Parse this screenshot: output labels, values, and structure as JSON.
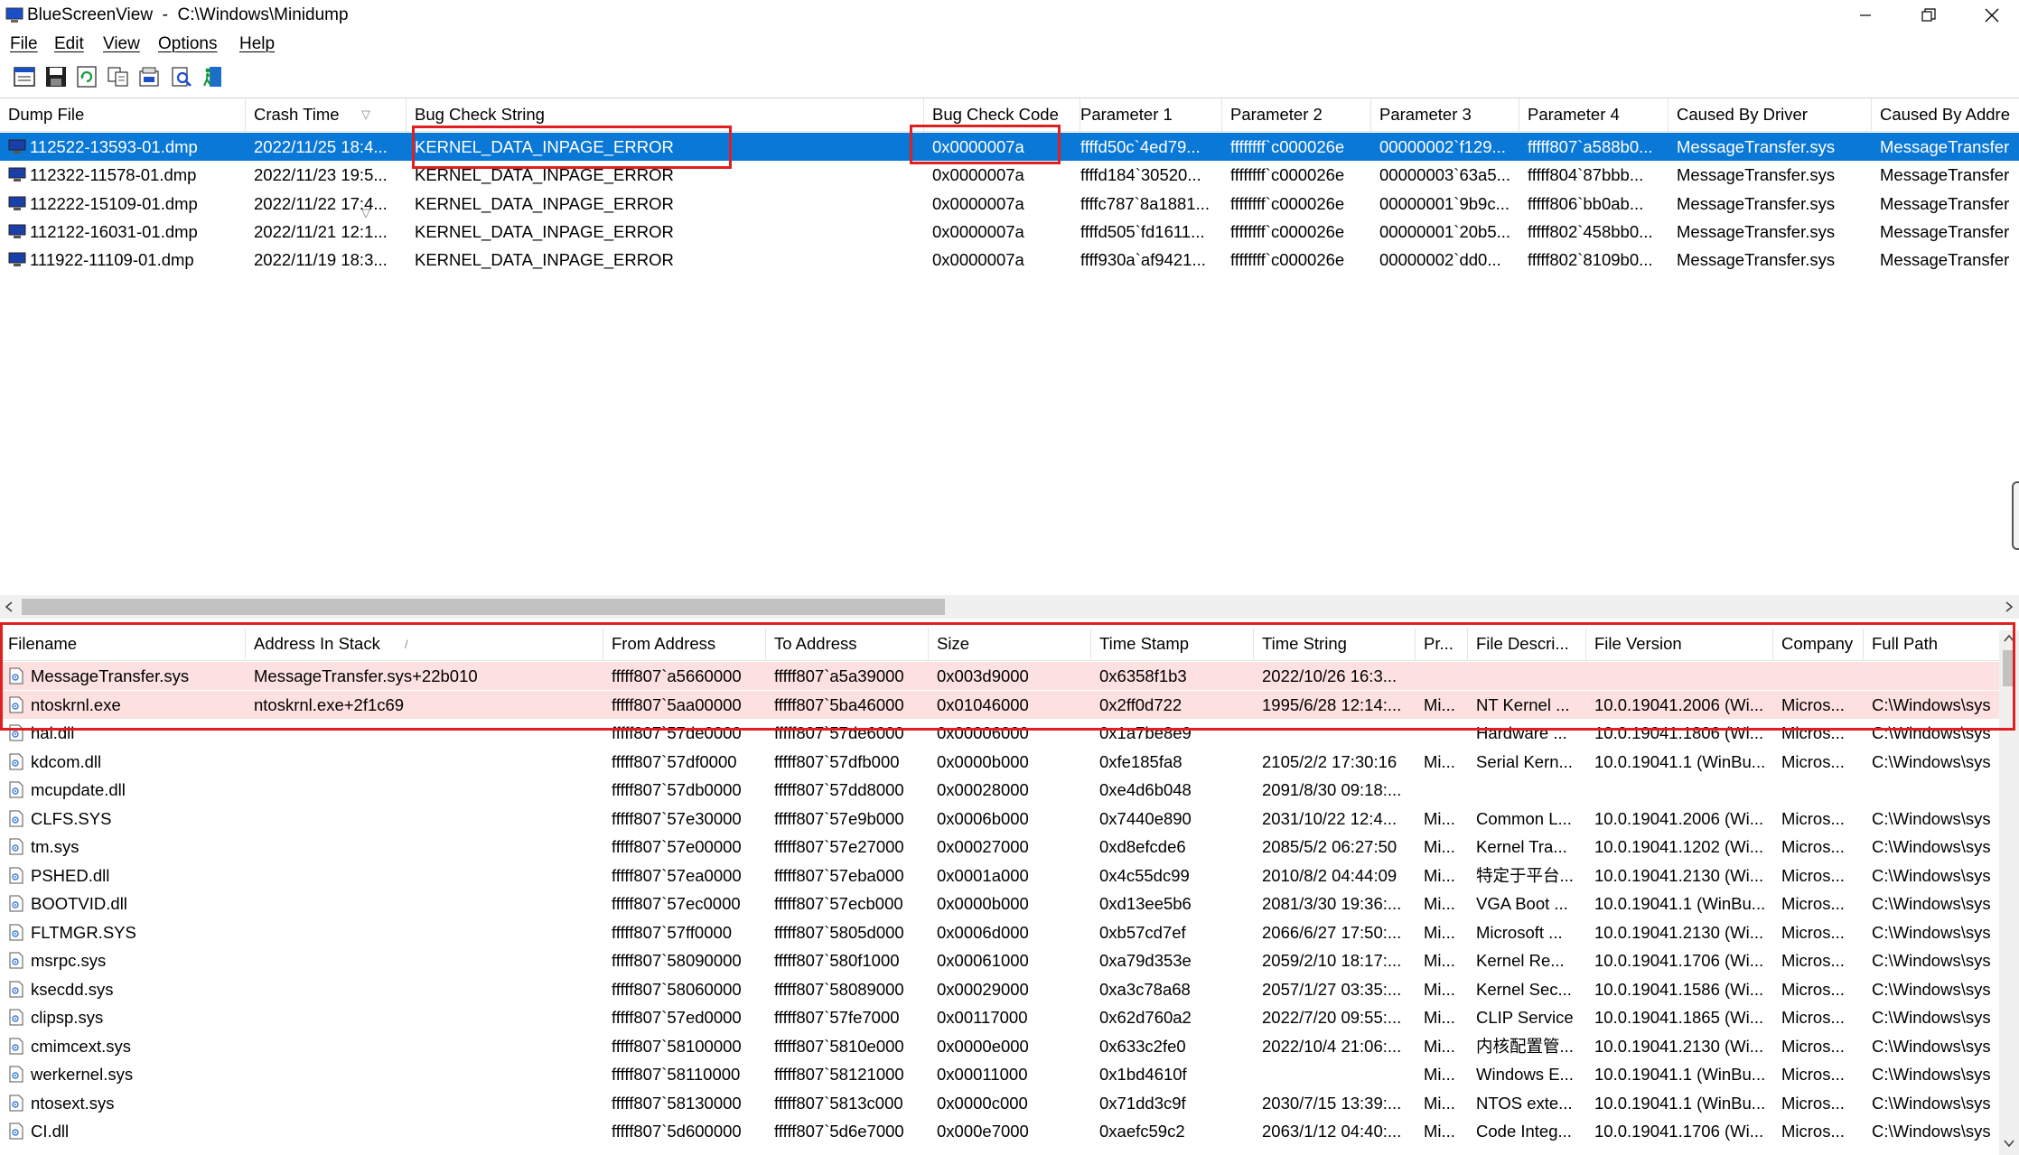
{
  "window": {
    "app_name": "BlueScreenView",
    "separator": "-",
    "folder": "C:\\Windows\\Minidump",
    "controls": [
      "minimize",
      "restore",
      "close"
    ]
  },
  "menu": [
    "File",
    "Edit",
    "View",
    "Options",
    "Help"
  ],
  "toolbar": [
    "properties-icon",
    "save-icon",
    "refresh-icon",
    "copy-icon",
    "html-report-icon",
    "find-icon",
    "exit-icon"
  ],
  "upper": {
    "columns": [
      "Dump File",
      "Crash Time",
      "Bug Check String",
      "Bug Check Code",
      "Parameter 1",
      "Parameter 2",
      "Parameter 3",
      "Parameter 4",
      "Caused By Driver",
      "Caused By Addre"
    ],
    "sorted_column": "Crash Time",
    "rows": [
      [
        "112522-13593-01.dmp",
        "2022/11/25 18:4...",
        "KERNEL_DATA_INPAGE_ERROR",
        "0x0000007a",
        "ffffd50c`4ed79...",
        "ffffffff`c000026e",
        "00000002`f129...",
        "fffff807`a588b0...",
        "MessageTransfer.sys",
        "MessageTransfer"
      ],
      [
        "112322-11578-01.dmp",
        "2022/11/23 19:5...",
        "KERNEL_DATA_INPAGE_ERROR",
        "0x0000007a",
        "ffffd184`30520...",
        "ffffffff`c000026e",
        "00000003`63a5...",
        "fffff804`87bbb...",
        "MessageTransfer.sys",
        "MessageTransfer"
      ],
      [
        "112222-15109-01.dmp",
        "2022/11/22 17:4...",
        "KERNEL_DATA_INPAGE_ERROR",
        "0x0000007a",
        "ffffc787`8a1881...",
        "ffffffff`c000026e",
        "00000001`9b9c...",
        "fffff806`bb0ab...",
        "MessageTransfer.sys",
        "MessageTransfer"
      ],
      [
        "112122-16031-01.dmp",
        "2022/11/21 12:1...",
        "KERNEL_DATA_INPAGE_ERROR",
        "0x0000007a",
        "ffffd505`fd1611...",
        "ffffffff`c000026e",
        "00000001`20b5...",
        "fffff802`458bb0...",
        "MessageTransfer.sys",
        "MessageTransfer"
      ],
      [
        "111922-11109-01.dmp",
        "2022/11/19 18:3...",
        "KERNEL_DATA_INPAGE_ERROR",
        "0x0000007a",
        "ffff930a`af9421...",
        "ffffffff`c000026e",
        "00000002`dd0...",
        "fffff802`8109b0...",
        "MessageTransfer.sys",
        "MessageTransfer"
      ]
    ]
  },
  "lower": {
    "columns": [
      "Filename",
      "Address In Stack",
      "From Address",
      "To Address",
      "Size",
      "Time Stamp",
      "Time String",
      "Pr...",
      "File Descri...",
      "File Version",
      "Company",
      "Full Path"
    ],
    "sorted_column": "Address In Stack",
    "rows": [
      [
        "MessageTransfer.sys",
        "MessageTransfer.sys+22b010",
        "fffff807`a5660000",
        "fffff807`a5a39000",
        "0x003d9000",
        "0x6358f1b3",
        "2022/10/26 16:3...",
        "",
        "",
        "",
        "",
        ""
      ],
      [
        "ntoskrnl.exe",
        "ntoskrnl.exe+2f1c69",
        "fffff807`5aa00000",
        "fffff807`5ba46000",
        "0x01046000",
        "0x2ff0d722",
        "1995/6/28 12:14:...",
        "Mi...",
        "NT Kernel ...",
        "10.0.19041.2006 (Wi...",
        "Micros...",
        "C:\\Windows\\sys"
      ],
      [
        "hal.dll",
        "",
        "fffff807`57de0000",
        "fffff807`57de6000",
        "0x00006000",
        "0x1a7be8e9",
        "",
        "",
        "Hardware ...",
        "10.0.19041.1806 (Wi...",
        "Micros...",
        "C:\\Windows\\sys"
      ],
      [
        "kdcom.dll",
        "",
        "fffff807`57df0000",
        "fffff807`57dfb000",
        "0x0000b000",
        "0xfe185fa8",
        "2105/2/2 17:30:16",
        "Mi...",
        "Serial Kern...",
        "10.0.19041.1 (WinBu...",
        "Micros...",
        "C:\\Windows\\sys"
      ],
      [
        "mcupdate.dll",
        "",
        "fffff807`57db0000",
        "fffff807`57dd8000",
        "0x00028000",
        "0xe4d6b048",
        "2091/8/30 09:18:...",
        "",
        "",
        "",
        "",
        ""
      ],
      [
        "CLFS.SYS",
        "",
        "fffff807`57e30000",
        "fffff807`57e9b000",
        "0x0006b000",
        "0x7440e890",
        "2031/10/22 12:4...",
        "Mi...",
        "Common L...",
        "10.0.19041.2006 (Wi...",
        "Micros...",
        "C:\\Windows\\sys"
      ],
      [
        "tm.sys",
        "",
        "fffff807`57e00000",
        "fffff807`57e27000",
        "0x00027000",
        "0xd8efcde6",
        "2085/5/2 06:27:50",
        "Mi...",
        "Kernel Tra...",
        "10.0.19041.1202 (Wi...",
        "Micros...",
        "C:\\Windows\\sys"
      ],
      [
        "PSHED.dll",
        "",
        "fffff807`57ea0000",
        "fffff807`57eba000",
        "0x0001a000",
        "0x4c55dc99",
        "2010/8/2 04:44:09",
        "Mi...",
        "特定于平台...",
        "10.0.19041.2130 (Wi...",
        "Micros...",
        "C:\\Windows\\sys"
      ],
      [
        "BOOTVID.dll",
        "",
        "fffff807`57ec0000",
        "fffff807`57ecb000",
        "0x0000b000",
        "0xd13ee5b6",
        "2081/3/30 19:36:...",
        "Mi...",
        "VGA Boot ...",
        "10.0.19041.1 (WinBu...",
        "Micros...",
        "C:\\Windows\\sys"
      ],
      [
        "FLTMGR.SYS",
        "",
        "fffff807`57ff0000",
        "fffff807`5805d000",
        "0x0006d000",
        "0xb57cd7ef",
        "2066/6/27 17:50:...",
        "Mi...",
        "Microsoft ...",
        "10.0.19041.2130 (Wi...",
        "Micros...",
        "C:\\Windows\\sys"
      ],
      [
        "msrpc.sys",
        "",
        "fffff807`58090000",
        "fffff807`580f1000",
        "0x00061000",
        "0xa79d353e",
        "2059/2/10 18:17:...",
        "Mi...",
        "Kernel Re...",
        "10.0.19041.1706 (Wi...",
        "Micros...",
        "C:\\Windows\\sys"
      ],
      [
        "ksecdd.sys",
        "",
        "fffff807`58060000",
        "fffff807`58089000",
        "0x00029000",
        "0xa3c78a68",
        "2057/1/27 03:35:...",
        "Mi...",
        "Kernel Sec...",
        "10.0.19041.1586 (Wi...",
        "Micros...",
        "C:\\Windows\\sys"
      ],
      [
        "clipsp.sys",
        "",
        "fffff807`57ed0000",
        "fffff807`57fe7000",
        "0x00117000",
        "0x62d760a2",
        "2022/7/20 09:55:...",
        "Mi...",
        "CLIP Service",
        "10.0.19041.1865 (Wi...",
        "Micros...",
        "C:\\Windows\\sys"
      ],
      [
        "cmimcext.sys",
        "",
        "fffff807`58100000",
        "fffff807`5810e000",
        "0x0000e000",
        "0x633c2fe0",
        "2022/10/4 21:06:...",
        "Mi...",
        "内核配置管...",
        "10.0.19041.2130 (Wi...",
        "Micros...",
        "C:\\Windows\\sys"
      ],
      [
        "werkernel.sys",
        "",
        "fffff807`58110000",
        "fffff807`58121000",
        "0x00011000",
        "0x1bd4610f",
        "",
        "Mi...",
        "Windows E...",
        "10.0.19041.1 (WinBu...",
        "Micros...",
        "C:\\Windows\\sys"
      ],
      [
        "ntosext.sys",
        "",
        "fffff807`58130000",
        "fffff807`5813c000",
        "0x0000c000",
        "0x71dd3c9f",
        "2030/7/15 13:39:...",
        "Mi...",
        "NTOS exte...",
        "10.0.19041.1 (WinBu...",
        "Micros...",
        "C:\\Windows\\sys"
      ],
      [
        "CI.dll",
        "",
        "fffff807`5d600000",
        "fffff807`5d6e7000",
        "0x000e7000",
        "0xaefc59c2",
        "2063/1/12 04:40:...",
        "Mi...",
        "Code Integ...",
        "10.0.19041.1706 (Wi...",
        "Micros...",
        "C:\\Windows\\sys"
      ]
    ]
  },
  "colors": {
    "selection": "#0a78d7",
    "highlight_row": "#fde0e0",
    "annotation_box": "#e02020"
  }
}
